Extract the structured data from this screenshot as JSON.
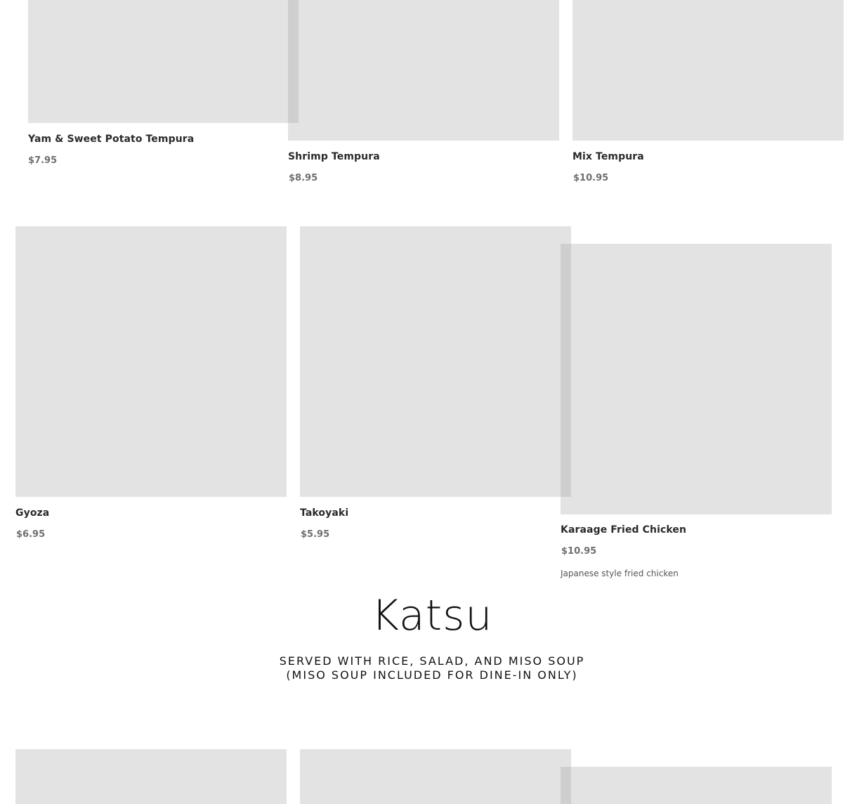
{
  "items": [
    {
      "name": "Yam & Sweet Potato Tempura",
      "price": "$7.95"
    },
    {
      "name": "Shrimp Tempura",
      "price": "$8.95"
    },
    {
      "name": "Mix Tempura",
      "price": "$10.95"
    },
    {
      "name": "Gyoza",
      "price": "$6.95"
    },
    {
      "name": "Takoyaki",
      "price": "$5.95"
    },
    {
      "name": "Karaage Fried Chicken",
      "price": "$10.95",
      "description": "Japanese style fried chicken"
    }
  ],
  "section": {
    "title": "Katsu",
    "subtitle_line1": "SERVED WITH RICE, SALAD, AND MISO SOUP",
    "subtitle_line2": "(MISO SOUP INCLUDED FOR DINE-IN ONLY)"
  }
}
